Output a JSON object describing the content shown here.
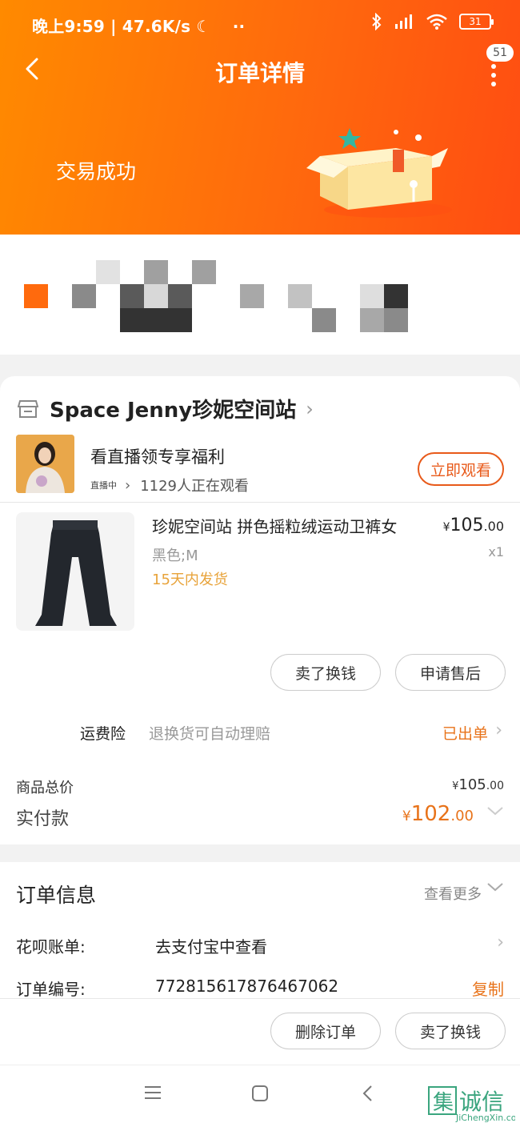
{
  "status_bar": {
    "time_speed": "晚上9:59 | 47.6K/s",
    "moon_icon": "☾",
    "dots": "··",
    "battery": "31"
  },
  "header": {
    "title": "订单详情",
    "notification_count": "51",
    "order_status": "交易成功"
  },
  "shop": {
    "name": "Space Jenny珍妮空间站"
  },
  "live": {
    "title": "看直播领专享福利",
    "tag": "直播中",
    "viewers": "1129人正在观看",
    "watch_button": "立即观看"
  },
  "product": {
    "name": "珍妮空间站 拼色摇粒绒运动卫裤女",
    "spec": "黑色;M",
    "shipping": "15天内发货",
    "price_currency": "¥",
    "price_int": "105",
    "price_dec": ".00",
    "qty": "x1"
  },
  "actions": {
    "sell_button": "卖了换钱",
    "aftersale_button": "申请售后"
  },
  "insurance": {
    "label": "运费险",
    "desc": "退换货可自动理赔",
    "status": "已出单"
  },
  "totals": {
    "goods_label": "商品总价",
    "goods_cur": "¥",
    "goods_int": "105",
    "goods_dec": ".00",
    "paid_label": "实付款",
    "paid_cur": "¥",
    "paid_int": "102",
    "paid_dec": ".00"
  },
  "order_info": {
    "title": "订单信息",
    "more": "查看更多",
    "huabei_label": "花呗账单:",
    "huabei_value": "去支付宝中查看",
    "order_no_label": "订单编号:",
    "order_no": "772815617876467062",
    "copy": "复制"
  },
  "bottom_bar": {
    "delete_button": "删除订单",
    "sell_button": "卖了换钱"
  },
  "watermark": {
    "text": "诚信",
    "url": "JiChengXin.com"
  },
  "colors": {
    "accent": "#ff6a0d",
    "price": "#e8731a",
    "ship": "#e8a33a"
  }
}
